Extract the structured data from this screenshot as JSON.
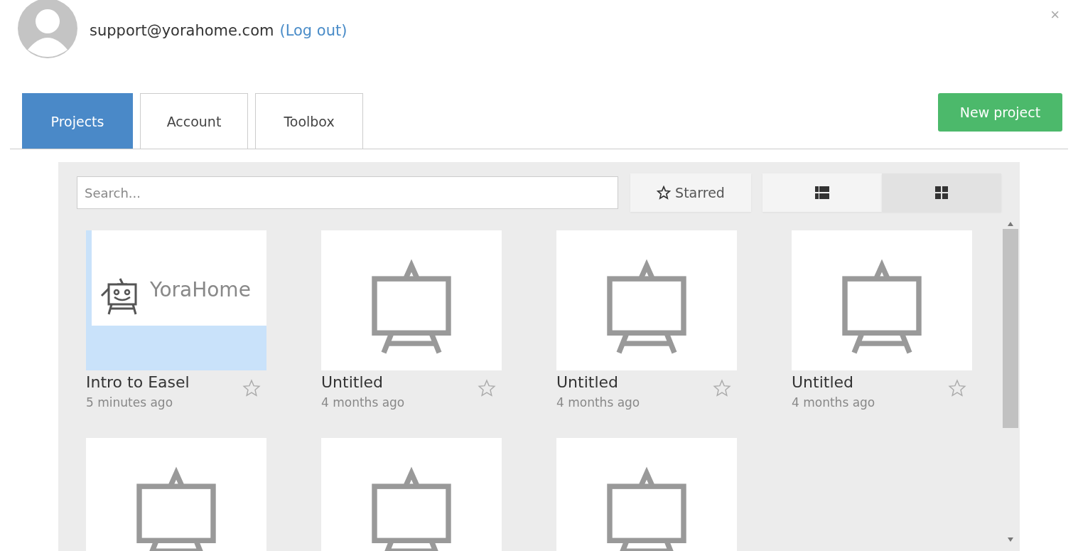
{
  "user": {
    "email": "support@yorahome.com",
    "logout": "(Log out)"
  },
  "close": "×",
  "tabs": [
    {
      "label": "Projects",
      "selected": true
    },
    {
      "label": "Account",
      "selected": false
    },
    {
      "label": "Toolbox",
      "selected": false
    }
  ],
  "new_project": "New project",
  "search": {
    "placeholder": "Search..."
  },
  "starred_filter": {
    "label": "Starred",
    "selected": false
  },
  "views": [
    {
      "kind": "list",
      "selected": false
    },
    {
      "kind": "grid",
      "selected": true
    }
  ],
  "projects": [
    {
      "kind": "image",
      "logo_text": "YoraHome",
      "title": "Intro to Easel",
      "time": "5 minutes ago",
      "starred": false
    },
    {
      "kind": "easel",
      "title": "Untitled",
      "time": "4 months ago",
      "starred": false
    },
    {
      "kind": "easel",
      "title": "Untitled",
      "time": "4 months ago",
      "starred": false
    },
    {
      "kind": "easel",
      "title": "Untitled",
      "time": "4 months ago",
      "starred": false
    },
    {
      "kind": "easel"
    },
    {
      "kind": "easel"
    },
    {
      "kind": "easel"
    }
  ]
}
